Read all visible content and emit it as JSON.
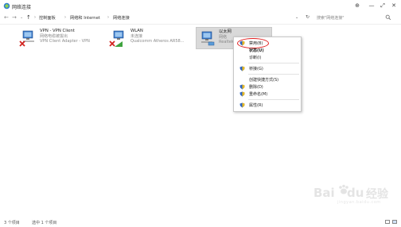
{
  "window": {
    "title": "网络连接",
    "minimize_glyph": "—",
    "maximize_glyph": "⤢",
    "close_glyph": "✕",
    "extra_glyph": "⊕"
  },
  "nav": {
    "back_glyph": "←",
    "forward_glyph": "→",
    "dropdown_glyph": "⌄",
    "up_glyph": "↑"
  },
  "breadcrumbs": [
    "控制面板",
    "网络和 Internet",
    "网络连接"
  ],
  "breadcrumb_separator": "›",
  "address": {
    "dropdown_glyph": "⌄",
    "refresh_glyph": "↻"
  },
  "search": {
    "placeholder": "搜索\"网络连接\""
  },
  "adapters": [
    {
      "name": "VPN - VPN Client",
      "status": "网络电缆被拔出",
      "device": "VPN Client Adapter - VPN",
      "state_icon": "red-x-icon"
    },
    {
      "name": "WLAN",
      "status": "未连接",
      "device": "Qualcomm Atheros AR58...",
      "state_icon": "red-x-icon"
    },
    {
      "name": "以太网",
      "status": "网络",
      "device": "Realtek",
      "state_icon": "green-check-icon"
    }
  ],
  "context_menu": {
    "items": [
      {
        "label": "禁用(B)",
        "shield": true,
        "bold": false
      },
      {
        "label": "状态(U)",
        "shield": false,
        "bold": true
      },
      {
        "label": "诊断(I)",
        "shield": false,
        "bold": false
      },
      {
        "label": "桥接(G)",
        "shield": true,
        "bold": false
      },
      {
        "label": "创建快捷方式(S)",
        "shield": false,
        "bold": false
      },
      {
        "label": "删除(D)",
        "shield": true,
        "bold": false
      },
      {
        "label": "重命名(M)",
        "shield": true,
        "bold": false
      },
      {
        "label": "属性(R)",
        "shield": true,
        "bold": false
      }
    ]
  },
  "status": {
    "item_count": "3 个项目",
    "selected_count": "选中 1 个项目"
  },
  "watermark": {
    "brand": "Bai",
    "brand_tail": "du",
    "suffix": "经验",
    "url": "jingyan.baidu.com"
  },
  "colors": {
    "highlight_ring": "#e02020",
    "selected_bg": "#d9d9d9"
  }
}
